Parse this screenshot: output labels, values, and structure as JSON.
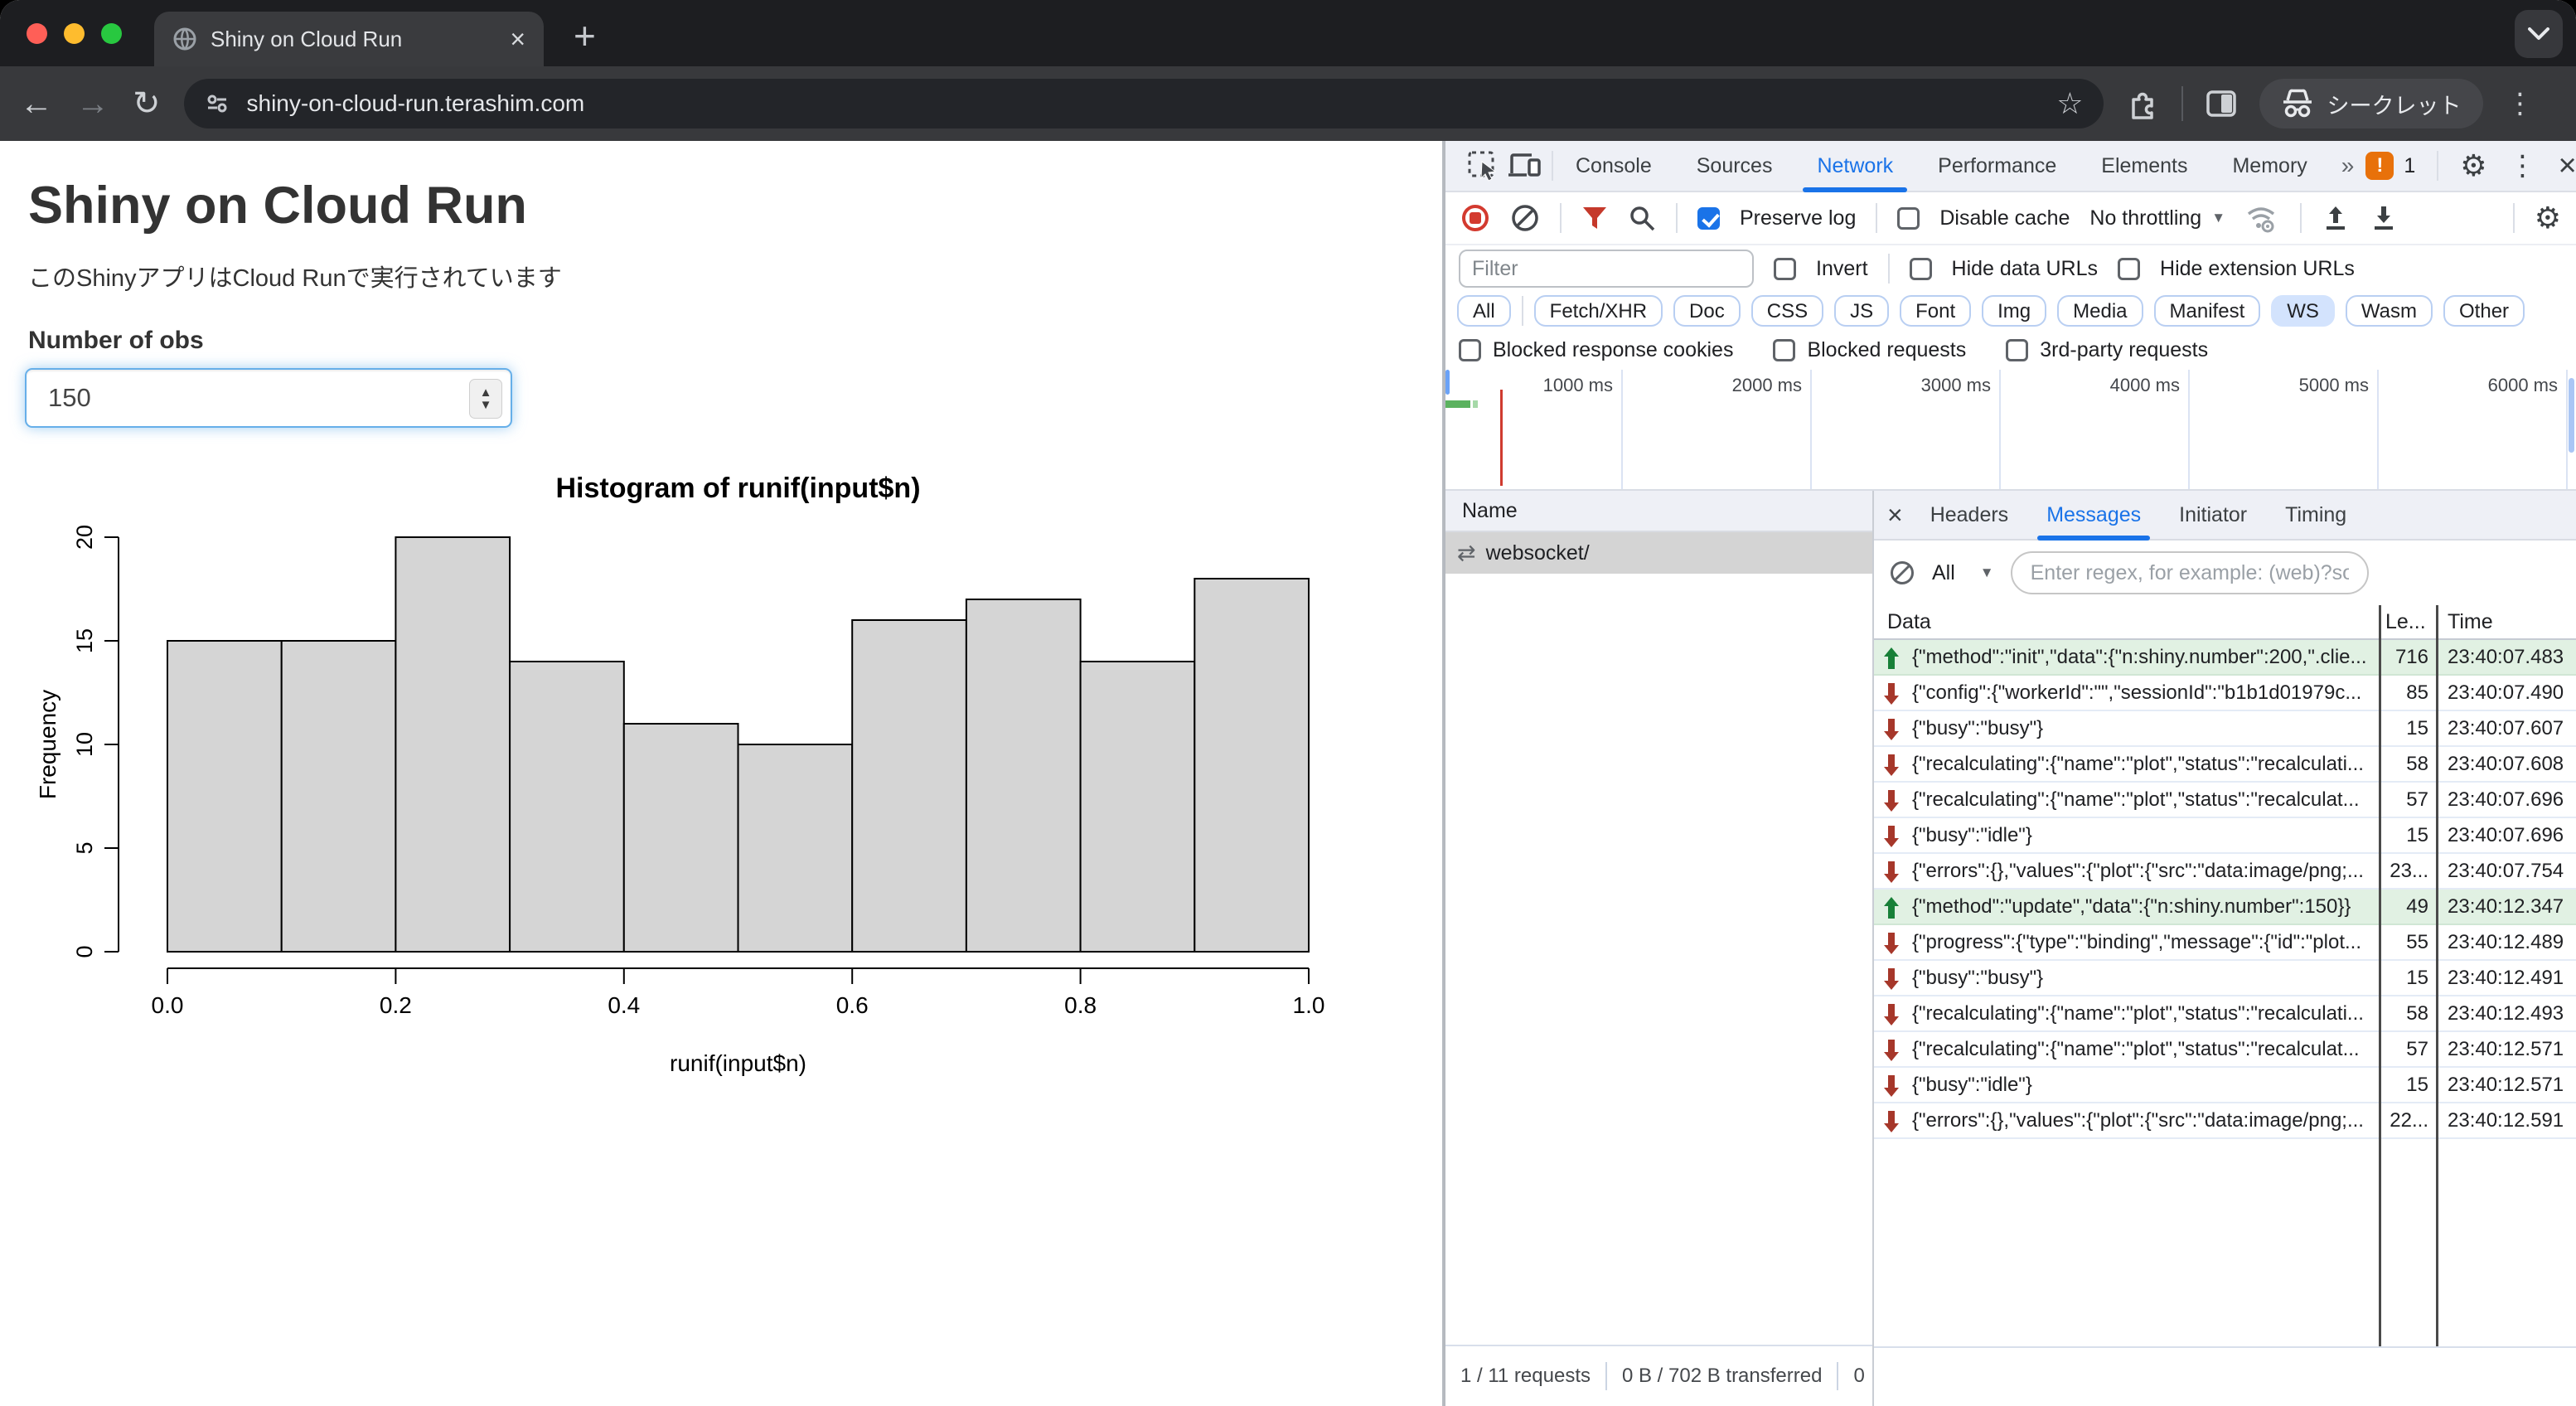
{
  "browser": {
    "tab_title": "Shiny on Cloud Run",
    "url": "shiny-on-cloud-run.terashim.com",
    "profile_chip": "シークレット",
    "traffic_colors": {
      "close": "#ff5f57",
      "minimize": "#febc2e",
      "zoom": "#28c840"
    }
  },
  "icons": {
    "back": "←",
    "forward": "→",
    "reload": "↻",
    "star": "☆",
    "kebab": "⋮",
    "close": "×",
    "plus": "+",
    "chevron_down": "⌄",
    "more_tabs": "»",
    "dropdown": "▼",
    "ws": "⇄",
    "spin_up": "▲",
    "spin_down": "▼",
    "bang": "!",
    "gear": "⚙"
  },
  "page": {
    "title": "Shiny on Cloud Run",
    "subtitle": "このShinyアプリはCloud Runで実行されています",
    "input_label": "Number of obs",
    "input_value": "150"
  },
  "chart_data": {
    "type": "bar",
    "title": "Histogram of runif(input$n)",
    "xlabel": "runif(input$n)",
    "ylabel": "Frequency",
    "bin_start": 0.0,
    "bin_width": 0.1,
    "values": [
      15,
      15,
      20,
      14,
      11,
      10,
      16,
      17,
      14,
      18
    ],
    "x_ticks": [
      0.0,
      0.2,
      0.4,
      0.6,
      0.8,
      1.0
    ],
    "x_tick_labels": [
      "0.0",
      "0.2",
      "0.4",
      "0.6",
      "0.8",
      "1.0"
    ],
    "y_ticks": [
      0,
      5,
      10,
      15,
      20
    ],
    "xlim": [
      0,
      1
    ],
    "ylim": [
      0,
      20
    ],
    "bar_fill": "#d5d5d5",
    "grid": false,
    "legend": false
  },
  "devtools": {
    "tabs": [
      "Console",
      "Sources",
      "Network",
      "Performance",
      "Elements",
      "Memory"
    ],
    "active_tab": "Network",
    "issues_count": "1",
    "network_toolbar": {
      "preserve_log": "Preserve log",
      "disable_cache": "Disable cache",
      "throttling": "No throttling"
    },
    "filter_bar": {
      "placeholder": "Filter",
      "invert": "Invert",
      "hide_data_urls": "Hide data URLs",
      "hide_extension_urls": "Hide extension URLs"
    },
    "chips": [
      "All",
      "Fetch/XHR",
      "Doc",
      "CSS",
      "JS",
      "Font",
      "Img",
      "Media",
      "Manifest",
      "WS",
      "Wasm",
      "Other"
    ],
    "active_chip": "WS",
    "blocked_row": [
      "Blocked response cookies",
      "Blocked requests",
      "3rd-party requests"
    ],
    "timeline_labels": [
      "1000 ms",
      "2000 ms",
      "3000 ms",
      "4000 ms",
      "5000 ms",
      "6000 ms"
    ],
    "name_panel": {
      "header": "Name",
      "selected_row": "websocket/"
    },
    "messages_panel": {
      "tabs": [
        "Headers",
        "Messages",
        "Initiator",
        "Timing"
      ],
      "active_tab": "Messages",
      "filter_all": "All",
      "regex_placeholder": "Enter regex, for example: (web)?socket",
      "columns": [
        "Data",
        "Le...",
        "Time"
      ],
      "rows": [
        {
          "dir": "sent",
          "data": "{\"method\":\"init\",\"data\":{\"n:shiny.number\":200,\".clie...",
          "len": "716",
          "time": "23:40:07.483"
        },
        {
          "dir": "recv",
          "data": "{\"config\":{\"workerId\":\"\",\"sessionId\":\"b1b1d01979c...",
          "len": "85",
          "time": "23:40:07.490"
        },
        {
          "dir": "recv",
          "data": "{\"busy\":\"busy\"}",
          "len": "15",
          "time": "23:40:07.607"
        },
        {
          "dir": "recv",
          "data": "{\"recalculating\":{\"name\":\"plot\",\"status\":\"recalculati...",
          "len": "58",
          "time": "23:40:07.608"
        },
        {
          "dir": "recv",
          "data": "{\"recalculating\":{\"name\":\"plot\",\"status\":\"recalculat...",
          "len": "57",
          "time": "23:40:07.696"
        },
        {
          "dir": "recv",
          "data": "{\"busy\":\"idle\"}",
          "len": "15",
          "time": "23:40:07.696"
        },
        {
          "dir": "recv",
          "data": "{\"errors\":{},\"values\":{\"plot\":{\"src\":\"data:image/png;...",
          "len": "23...",
          "time": "23:40:07.754"
        },
        {
          "dir": "sent",
          "data": "{\"method\":\"update\",\"data\":{\"n:shiny.number\":150}}",
          "len": "49",
          "time": "23:40:12.347"
        },
        {
          "dir": "recv",
          "data": "{\"progress\":{\"type\":\"binding\",\"message\":{\"id\":\"plot...",
          "len": "55",
          "time": "23:40:12.489"
        },
        {
          "dir": "recv",
          "data": "{\"busy\":\"busy\"}",
          "len": "15",
          "time": "23:40:12.491"
        },
        {
          "dir": "recv",
          "data": "{\"recalculating\":{\"name\":\"plot\",\"status\":\"recalculati...",
          "len": "58",
          "time": "23:40:12.493"
        },
        {
          "dir": "recv",
          "data": "{\"recalculating\":{\"name\":\"plot\",\"status\":\"recalculat...",
          "len": "57",
          "time": "23:40:12.571"
        },
        {
          "dir": "recv",
          "data": "{\"busy\":\"idle\"}",
          "len": "15",
          "time": "23:40:12.571"
        },
        {
          "dir": "recv",
          "data": "{\"errors\":{},\"values\":{\"plot\":{\"src\":\"data:image/png;...",
          "len": "22...",
          "time": "23:40:12.591"
        }
      ]
    },
    "status_bar": [
      "1 / 11 requests",
      "0 B / 702 B transferred",
      "0"
    ]
  },
  "colors": {
    "accent_blue": "#1a73e8",
    "sent_green": "#188038",
    "recv_red": "#a6372a",
    "sent_row_bg": "#e1f1e3",
    "record_red": "#d33a2f",
    "funnel_red": "#c5392b",
    "badge_orange": "#e8710a",
    "chip_active_bg": "#d3e3fd",
    "selection_gray": "#d4d4d4"
  }
}
